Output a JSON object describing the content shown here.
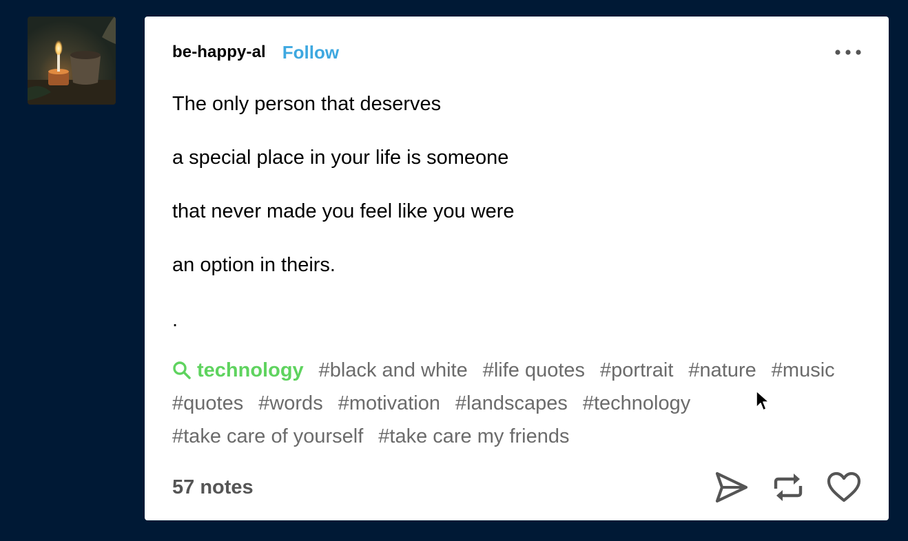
{
  "post": {
    "blog_name": "be-happy-al",
    "follow_label": "Follow",
    "more_icon": "more-options-icon",
    "body_lines": [
      "The only person that deserves",
      "a special place in your life is someone",
      "that never made you feel like you were",
      "an option in theirs.",
      "."
    ],
    "search_tag": {
      "icon": "search-icon",
      "label": "technology"
    },
    "tags": [
      "#black and white",
      "#life quotes",
      "#portrait",
      "#nature",
      "#music",
      "#quotes",
      "#words",
      "#motivation",
      "#landscapes",
      "#technology",
      "#take care of yourself",
      "#take care my friends"
    ],
    "notes_label": "57 notes",
    "actions": {
      "share_icon": "share-icon",
      "reblog_icon": "reblog-icon",
      "like_icon": "heart-icon"
    }
  },
  "colors": {
    "page_background": "#001935",
    "follow": "#3ea8e0",
    "search_tag": "#5fd35f",
    "tag_text": "#6b6b6b"
  }
}
